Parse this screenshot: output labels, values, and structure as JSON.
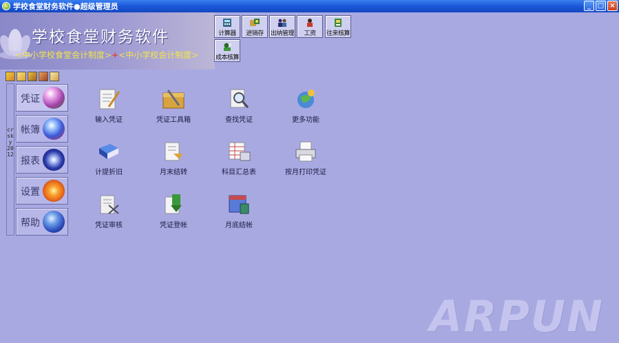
{
  "window": {
    "title": "学校食堂财务软件●超级管理员",
    "minimize_label": "_",
    "maximize_label": "□",
    "close_label": "×"
  },
  "banner": {
    "title": "学校食堂财务软件",
    "sub_left": "<中小学校食堂会计制度>",
    "sub_plus": "+",
    "sub_right": "<中小学校会计制度>"
  },
  "toolbar": [
    {
      "label": "计算器",
      "icon": "calculator-icon"
    },
    {
      "label": "进销存",
      "icon": "inventory-icon"
    },
    {
      "label": "出纳管理",
      "icon": "cashier-icon"
    },
    {
      "label": "工资",
      "icon": "salary-icon"
    },
    {
      "label": "往来核算",
      "icon": "accounts-icon"
    },
    {
      "label": "成本核算",
      "icon": "cost-icon"
    }
  ],
  "side_vertical_text": "crsky 2012",
  "nav": [
    {
      "label": "凭证",
      "icon": "flower-orb-icon",
      "color": "#c060c0"
    },
    {
      "label": "帐簿",
      "icon": "swirl-orb-icon",
      "color": "#3a5ad8"
    },
    {
      "label": "报表",
      "icon": "star-orb-icon",
      "color": "#2a3aa8"
    },
    {
      "label": "设置",
      "icon": "fire-orb-icon",
      "color": "#e86a1a"
    },
    {
      "label": "帮助",
      "icon": "globe-orb-icon",
      "color": "#2a4ab8"
    }
  ],
  "functions": [
    {
      "label": "输入凭证",
      "icon": "edit-document-icon"
    },
    {
      "label": "凭证工具箱",
      "icon": "toolbox-icon"
    },
    {
      "label": "查找凭证",
      "icon": "search-document-icon"
    },
    {
      "label": "更多功能",
      "icon": "more-functions-icon"
    },
    {
      "label": "计提折旧",
      "icon": "book-icon"
    },
    {
      "label": "月末结转",
      "icon": "month-end-icon"
    },
    {
      "label": "科目汇总表",
      "icon": "summary-table-icon"
    },
    {
      "label": "按月打印凭证",
      "icon": "printer-icon"
    },
    {
      "label": "凭证审核",
      "icon": "audit-icon"
    },
    {
      "label": "凭证登帐",
      "icon": "post-ledger-icon"
    },
    {
      "label": "月底结帐",
      "icon": "month-close-icon"
    }
  ],
  "watermark": "ARPUN"
}
